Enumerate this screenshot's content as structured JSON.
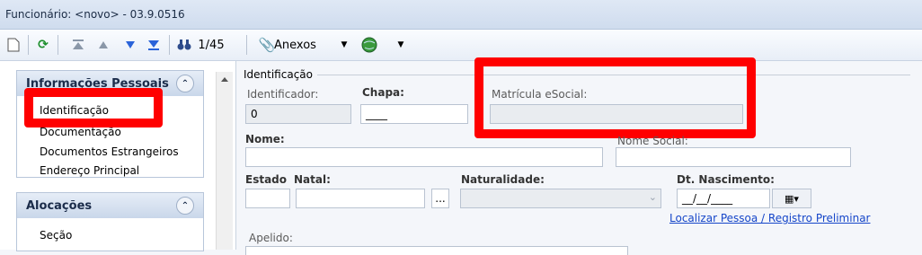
{
  "window": {
    "title": "Funcionário: <novo> - 03.9.0516"
  },
  "toolbar": {
    "record_counter": "1/45",
    "attachments_label": "Anexos"
  },
  "sidebar": {
    "groups": [
      {
        "title": "Informações Pessoais",
        "items": [
          "Identificação",
          "Documentação",
          "Documentos Estrangeiros",
          "Endereço Principal"
        ]
      },
      {
        "title": "Alocações",
        "items": [
          "Seção"
        ]
      }
    ]
  },
  "form": {
    "section_title": "Identificação",
    "identificador_label": "Identificador:",
    "identificador_value": "0",
    "chapa_label": "Chapa:",
    "chapa_value": "____",
    "matricula_label": "Matrícula eSocial:",
    "nome_label": "Nome:",
    "nome_social_label": "Nome Social:",
    "estado_natal_label_1": "Estado",
    "estado_natal_label_2": "Natal:",
    "naturalidade_label": "Naturalidade:",
    "dt_nascimento_label": "Dt. Nascimento:",
    "dt_nascimento_value": "__/__/____",
    "browse_label": "...",
    "link_label": "Localizar Pessoa / Registro Preliminar",
    "apelido_label": "Apelido:"
  },
  "colors": {
    "highlight": "#ff0000",
    "link": "#1546c9"
  }
}
